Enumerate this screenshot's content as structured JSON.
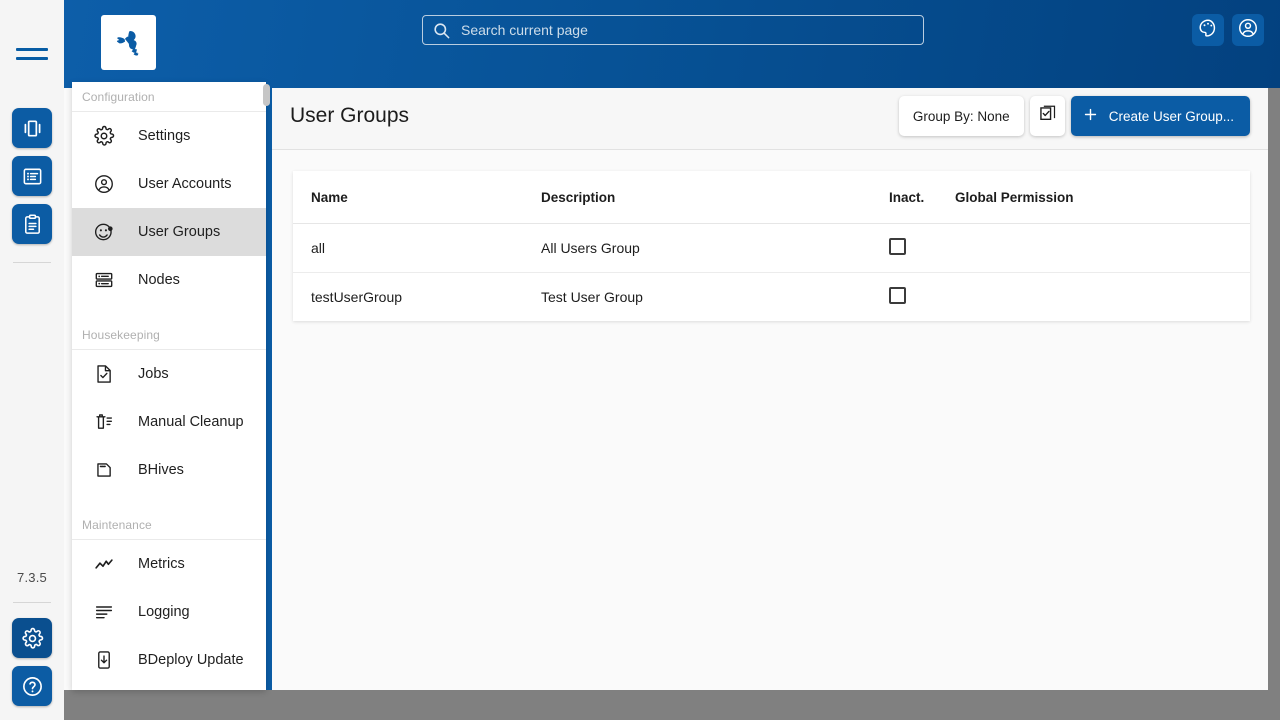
{
  "app": {
    "version": "7.3.5",
    "logo_icon": "bee-logo-icon",
    "accent_color": "#0b5ca5",
    "header_gradient_from": "#0d5ea9",
    "header_gradient_to": "#03417f"
  },
  "rail": {
    "menu_icon": "hamburger-menu-icon",
    "buttons": [
      {
        "icon": "instance-groups-icon",
        "name": "rail-instance-groups",
        "active": false
      },
      {
        "icon": "products-list-icon",
        "name": "rail-products",
        "active": false
      },
      {
        "icon": "clipboard-report-icon",
        "name": "rail-reports",
        "active": false
      }
    ],
    "bottom_buttons": [
      {
        "icon": "gear-icon",
        "name": "rail-admin-settings",
        "active": true
      },
      {
        "icon": "help-question-icon",
        "name": "rail-help",
        "active": false
      }
    ]
  },
  "search": {
    "placeholder": "Search current page",
    "value": "",
    "icon": "search-icon"
  },
  "top_actions": [
    {
      "icon": "palette-theme-icon",
      "name": "theme-toggle-button"
    },
    {
      "icon": "user-account-icon",
      "name": "user-account-button"
    }
  ],
  "sidebar": {
    "sections": [
      {
        "title": "Configuration",
        "items": [
          {
            "label": "Settings",
            "icon": "gear-icon",
            "selected": false
          },
          {
            "label": "User Accounts",
            "icon": "user-circle-icon",
            "selected": false
          },
          {
            "label": "User Groups",
            "icon": "user-group-icon",
            "selected": true
          },
          {
            "label": "Nodes",
            "icon": "server-nodes-icon",
            "selected": false
          }
        ]
      },
      {
        "title": "Housekeeping",
        "items": [
          {
            "label": "Jobs",
            "icon": "task-check-icon",
            "selected": false
          },
          {
            "label": "Manual Cleanup",
            "icon": "trash-list-icon",
            "selected": false
          },
          {
            "label": "BHives",
            "icon": "hive-icon",
            "selected": false
          }
        ]
      },
      {
        "title": "Maintenance",
        "items": [
          {
            "label": "Metrics",
            "icon": "chart-line-icon",
            "selected": false
          },
          {
            "label": "Logging",
            "icon": "logs-lines-icon",
            "selected": false
          },
          {
            "label": "BDeploy Update",
            "icon": "download-device-icon",
            "selected": false
          }
        ]
      }
    ]
  },
  "page": {
    "title": "User Groups",
    "actions": {
      "group_by_label": "Group By: None",
      "multi_select_icon": "checkbox-multi-select-icon",
      "create_label": "Create User Group...",
      "create_icon": "plus-icon"
    }
  },
  "table": {
    "columns": [
      "Name",
      "Description",
      "Inact.",
      "Global Permission"
    ],
    "rows": [
      {
        "name": "all",
        "description": "All Users Group",
        "inactive": false,
        "permission": ""
      },
      {
        "name": "testUserGroup",
        "description": "Test User Group",
        "inactive": false,
        "permission": ""
      }
    ]
  }
}
